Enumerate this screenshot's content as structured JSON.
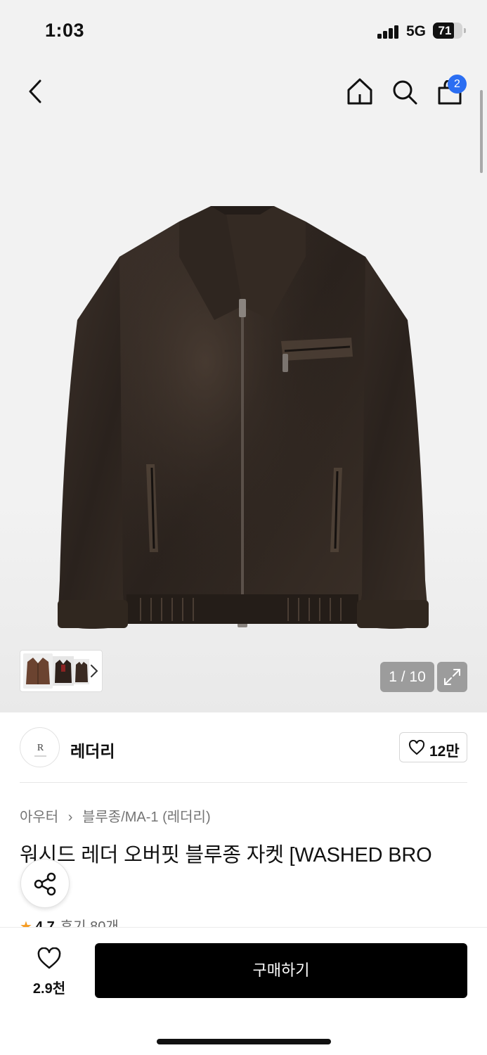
{
  "status_bar": {
    "time": "1:03",
    "network": "5G",
    "battery": "71",
    "battery_level": 0.71
  },
  "top_nav": {
    "icons": [
      "back-icon",
      "home-icon",
      "search-icon",
      "bag-icon"
    ],
    "cart_badge": "2"
  },
  "gallery": {
    "counter": "1 / 10",
    "current": 1,
    "total": 10
  },
  "brand": {
    "name": "레더리",
    "likes": "12만"
  },
  "breadcrumb": {
    "category": "아우터",
    "subcategory": "블루종/MA-1 (레더리)"
  },
  "product": {
    "title": "워시드 레더 오버핏 블루종 자켓 [WASHED BRO",
    "rating": "4.7",
    "reviews": "후기 80개"
  },
  "bottom_bar": {
    "wish_count": "2.9천",
    "buy_label": "구매하기"
  },
  "colors": {
    "accent": "#2b6ef2",
    "buy_button": "#000000",
    "star": "#f59b21"
  }
}
